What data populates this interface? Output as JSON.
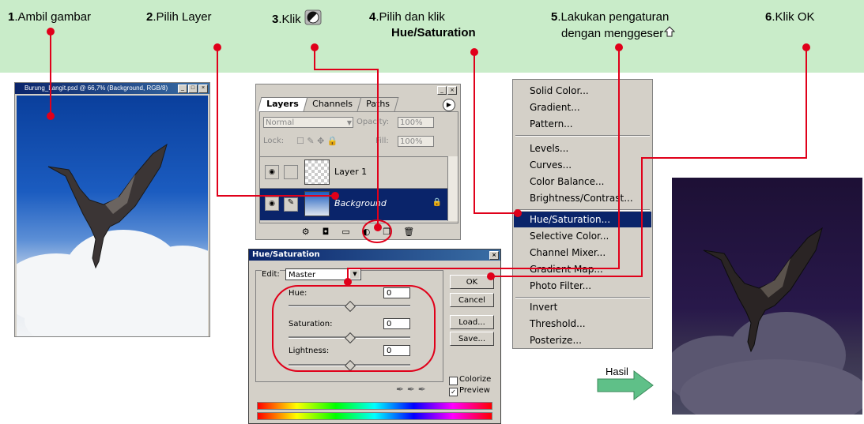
{
  "steps": [
    {
      "num": "1",
      "text": ".Ambil gambar"
    },
    {
      "num": "2",
      "text": ".Pilih Layer"
    },
    {
      "num": "3",
      "text": ".Klik"
    },
    {
      "num": "4",
      "text": ".Pilih dan klik",
      "bold": "Hue/Saturation"
    },
    {
      "num": "5",
      "text": ".Lakukan pengaturan",
      "line2": "dengan menggeser"
    },
    {
      "num": "6",
      "text": ".Klik OK"
    }
  ],
  "doc_window": {
    "title": "Burung_Langit.psd @ 66,7% (Background, RGB/8)"
  },
  "layers_panel": {
    "tabs": [
      "Layers",
      "Channels",
      "Paths"
    ],
    "blend_mode": "Normal",
    "opacity_label": "Opacity:",
    "opacity_value": "100%",
    "lock_label": "Lock:",
    "fill_label": "Fill:",
    "fill_value": "100%",
    "layers": [
      {
        "name": "Layer 1",
        "selected": false
      },
      {
        "name": "Background",
        "selected": true
      }
    ]
  },
  "hue_dialog": {
    "title": "Hue/Saturation",
    "edit_label": "Edit:",
    "edit_value": "Master",
    "hue_label": "Hue:",
    "hue_value": "0",
    "saturation_label": "Saturation:",
    "saturation_value": "0",
    "lightness_label": "Lightness:",
    "lightness_value": "0",
    "buttons": [
      "OK",
      "Cancel",
      "Load...",
      "Save..."
    ],
    "colorize_label": "Colorize",
    "preview_label": "Preview"
  },
  "menu": {
    "items": [
      "Solid Color...",
      "Gradient...",
      "Pattern...",
      "Levels...",
      "Curves...",
      "Color Balance...",
      "Brightness/Contrast...",
      "Hue/Saturation...",
      "Selective Color...",
      "Channel Mixer...",
      "Gradient Map...",
      "Photo Filter...",
      "Invert",
      "Threshold...",
      "Posterize..."
    ],
    "selected": "Hue/Saturation..."
  },
  "result": {
    "label": "Hasil"
  },
  "colors": {
    "banner": "#c9ecc9",
    "annotation": "#e0001a",
    "highlight": "#0a246a"
  }
}
